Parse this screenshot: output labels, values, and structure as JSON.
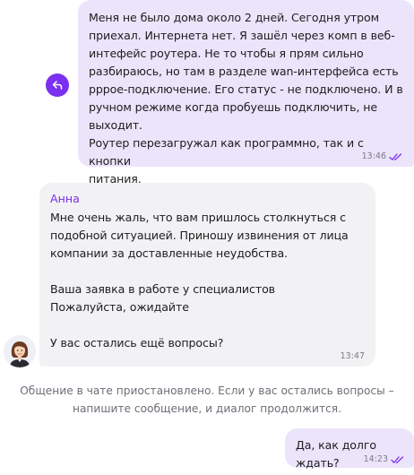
{
  "chat": {
    "messages": [
      {
        "text": "Меня не было дома около 2 дней. Сегодня утром\nприехал. Интернета нет. Я зашёл через комп в веб-\nинтефейс роутера. Не то чтобы я прям сильно\nразбираюсь, но там в разделе wan-интерфейса есть\npppoe-подключение. Его статус - не подключено. И в\nручном режиме когда пробуешь подключить, не выходит.\nРоутер перезагружал как программно, так и с кнопки\nпитания.",
        "time": "13:46"
      },
      {
        "author": "Анна",
        "text": "Мне очень жаль, что вам пришлось столкнуться с\nподобной ситуацией. Приношу извинения от лица\nкомпании за доставленные неудобства.\n\nВаша заявка в работе у специалистов\nПожалуйста, ожидайте\n\nУ вас остались ещё вопросы?",
        "time": "13:47"
      },
      {
        "text": "Да, как долго ждать?",
        "time": "14:23"
      }
    ],
    "system_notice": "Общение в чате приостановлено. Если у вас остались вопросы –\nнапишите сообщение, и диалог продолжится."
  },
  "icons": {
    "share": "share-reply-icon",
    "read": "double-check-icon",
    "avatar": "agent-avatar"
  },
  "colors": {
    "accent": "#7b2ff0",
    "user_bubble": "#ece4fb",
    "agent_bubble": "#f2f2f4",
    "author_name": "#7a2ee6",
    "read_check": "#7b2ff0"
  }
}
